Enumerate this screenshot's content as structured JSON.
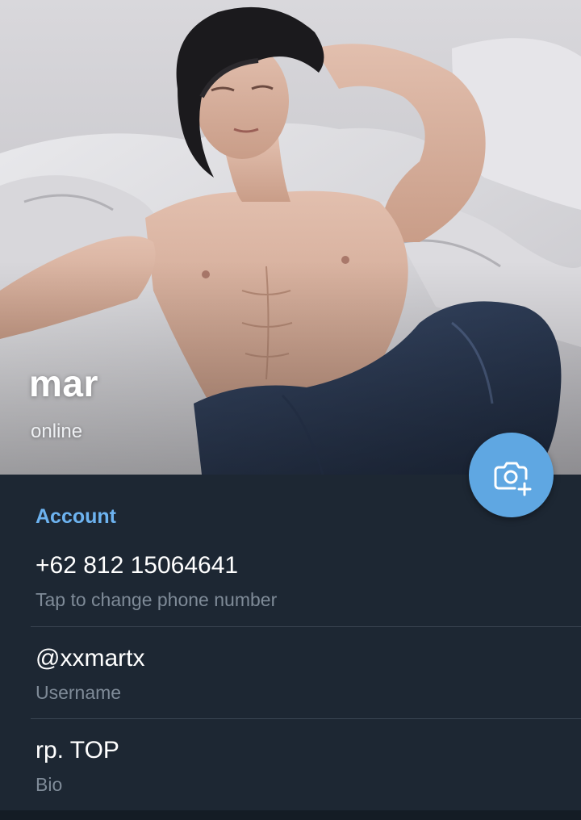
{
  "profile": {
    "name": "mar",
    "status": "online",
    "photo_icon": "camera-add-icon"
  },
  "account": {
    "section_title": "Account",
    "phone": {
      "value": "+62 812 15064641",
      "hint": "Tap to change phone number"
    },
    "username": {
      "value": "@xxmartx",
      "hint": "Username"
    },
    "bio": {
      "value": "rp. TOP",
      "hint": "Bio"
    }
  },
  "colors": {
    "background": "#1d2733",
    "accent": "#6db3f0",
    "fab": "#5fa7e2",
    "hint_text": "#7f8b98",
    "divider": "#3a4552"
  }
}
